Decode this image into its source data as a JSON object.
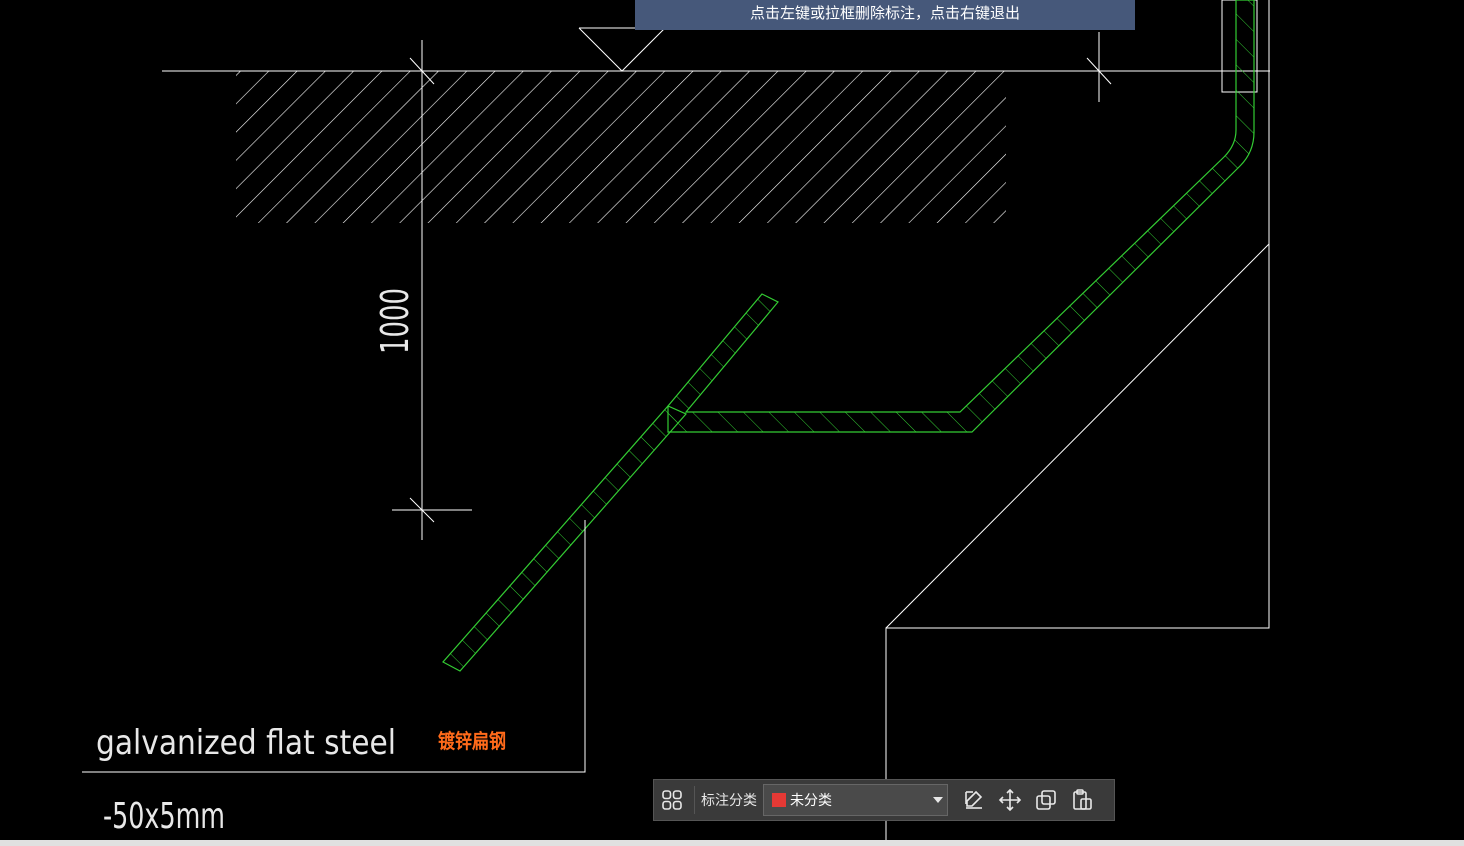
{
  "hint": {
    "text": "点击左键或拉框删除标注，点击右键退出"
  },
  "drawing": {
    "dimension_value": "1000",
    "label_en": "galvanized flat steel",
    "label_cn": "镀锌扁钢",
    "label_size": "-50x5mm"
  },
  "toolbar": {
    "category_label": "标注分类",
    "category_value": "未分类",
    "category_color": "#e53935"
  },
  "colors": {
    "background": "#000000",
    "lines": "#ffffff",
    "steel": "#33cc33",
    "label_cn": "#ff6a1a",
    "hint_bg": "#46587a"
  },
  "icons": {
    "grid": "apps-grid-icon",
    "edit": "edit-icon",
    "move": "move-icon",
    "copy": "copy-icon",
    "paste": "paste-icon"
  }
}
